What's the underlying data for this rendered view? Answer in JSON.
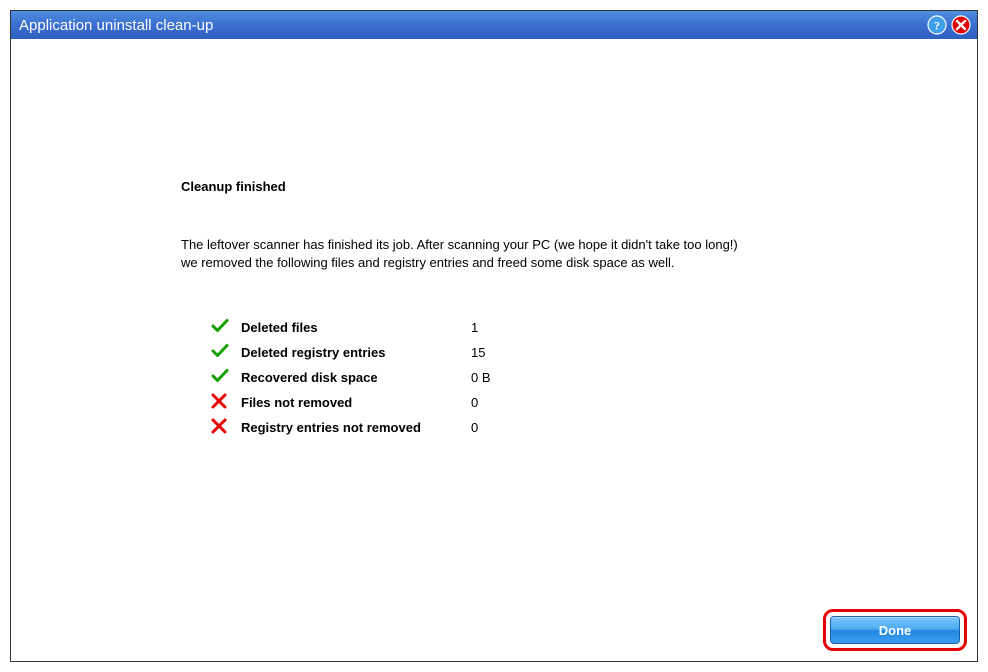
{
  "title": "Application uninstall clean-up",
  "heading": "Cleanup finished",
  "description_line1": "The leftover scanner has finished its job. After scanning your PC (we hope it didn't take too long!)",
  "description_line2": "we removed the following files and registry entries and freed some disk space as well.",
  "stats": {
    "deleted_files": {
      "label": "Deleted files",
      "value": "1",
      "ok": true
    },
    "deleted_registry": {
      "label": "Deleted registry entries",
      "value": "15",
      "ok": true
    },
    "recovered_space": {
      "label": "Recovered disk space",
      "value": "0 B",
      "ok": true
    },
    "files_not_removed": {
      "label": "Files not removed",
      "value": "0",
      "ok": false
    },
    "registry_not_removed": {
      "label": "Registry entries not removed",
      "value": "0",
      "ok": false
    }
  },
  "buttons": {
    "done": "Done"
  }
}
